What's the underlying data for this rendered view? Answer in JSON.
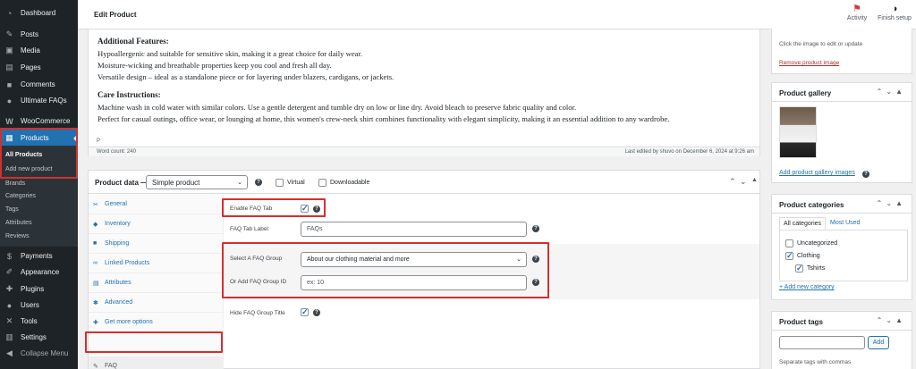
{
  "sidebar": {
    "menu": [
      {
        "label": "Dashboard",
        "icon": "dashboard-icon"
      },
      {
        "label": "Posts",
        "icon": "pin-icon"
      },
      {
        "label": "Media",
        "icon": "media-icon"
      },
      {
        "label": "Pages",
        "icon": "pages-icon"
      },
      {
        "label": "Comments",
        "icon": "comment-icon"
      },
      {
        "label": "Ultimate FAQs",
        "icon": "help-icon"
      },
      {
        "label": "WooCommerce",
        "icon": "woo-icon"
      },
      {
        "label": "Products",
        "icon": "archive-icon"
      }
    ],
    "submenu": [
      "All Products",
      "Add new product",
      "Brands",
      "Categories",
      "Tags",
      "Attributes",
      "Reviews"
    ],
    "lower_menu": [
      {
        "label": "Payments",
        "icon": "payments-icon"
      },
      {
        "label": "Appearance",
        "icon": "brush-icon"
      },
      {
        "label": "Plugins",
        "icon": "plugin-icon"
      },
      {
        "label": "Users",
        "icon": "user-icon"
      },
      {
        "label": "Tools",
        "icon": "wrench-icon"
      },
      {
        "label": "Settings",
        "icon": "settings-icon"
      },
      {
        "label": "Collapse Menu",
        "icon": "collapse-icon"
      }
    ]
  },
  "topbar": {
    "title": "Edit Product",
    "activity_label": "Activity",
    "finish_setup_label": "Finish setup"
  },
  "editor": {
    "additional_heading": "Additional Features:",
    "additional_lines": [
      "Hypoallergenic and suitable for sensitive skin, making it a great choice for daily wear.",
      "Moisture-wicking and breathable properties keep you cool and fresh all day.",
      "Versatile design – ideal as a standalone piece or for layering under blazers, cardigans, or jackets."
    ],
    "care_heading": "Care Instructions:",
    "care_lines": [
      "Machine wash in cold water with similar colors. Use a gentle detergent and tumble dry on low or line dry. Avoid bleach to preserve fabric quality and color.",
      "Perfect for casual outings, office wear, or lounging at home, this women's crew-neck shirt combines functionality with elegant simplicity, making it an essential addition to any wardrobe."
    ],
    "path": "P",
    "word_count": "Word count: 240",
    "last_edited": "Last edited by shuvo on December 6, 2024 at 9:26 am"
  },
  "product_data": {
    "title": "Product data —",
    "product_type": "Simple product",
    "virtual_label": "Virtual",
    "downloadable_label": "Downloadable",
    "tabs": [
      {
        "label": "General",
        "icon": "wrench-icon"
      },
      {
        "label": "Inventory",
        "icon": "tag-icon"
      },
      {
        "label": "Shipping",
        "icon": "truck-icon"
      },
      {
        "label": "Linked Products",
        "icon": "link-icon"
      },
      {
        "label": "Attributes",
        "icon": "list-icon"
      },
      {
        "label": "Advanced",
        "icon": "gear-icon"
      },
      {
        "label": "Get more options",
        "icon": "plugin-icon"
      },
      {
        "label": "FAQ",
        "icon": "pin-icon"
      }
    ],
    "fields": {
      "enable_faq_label": "Enable FAQ Tab",
      "faq_tab_label": "FAQ Tab Label",
      "faq_tab_value": "FAQs",
      "select_group_label": "Select A FAQ Group",
      "select_group_value": "About our clothing material and more",
      "add_group_label": "Or Add FAQ Group ID",
      "add_group_placeholder": "ex: 10",
      "hide_title_label": "Hide FAQ Group Title"
    }
  },
  "right": {
    "image_text": "Click the image to edit or update",
    "remove_image": "Remove product image",
    "gallery_title": "Product gallery",
    "add_gallery": "Add product gallery images",
    "categories_title": "Product categories",
    "all_categories": "All categories",
    "most_used": "Most Used",
    "categories": [
      "Uncategorized",
      "Clothing",
      "Tshirts"
    ],
    "add_category": "+ Add new category",
    "tags_title": "Product tags",
    "add_button": "Add",
    "tags_hint": "Separate tags with commas"
  },
  "colors": {
    "accent": "#2271b1",
    "sidebar": "#1d2327",
    "highlight": "#d32f2f"
  }
}
